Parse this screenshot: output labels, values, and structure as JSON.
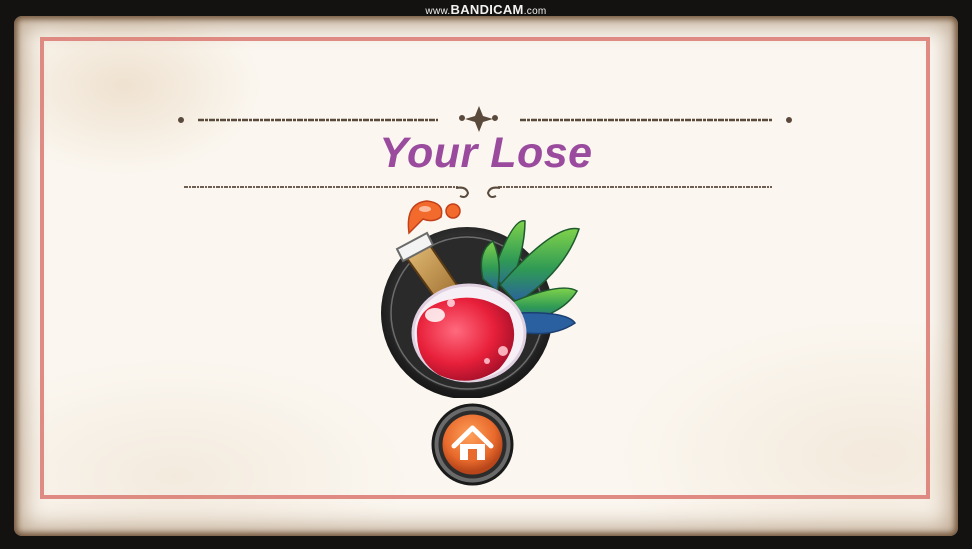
{
  "watermark": {
    "prefix": "www.",
    "brand": "BANDICAM",
    "suffix": ".com"
  },
  "result": {
    "title": "Your Lose"
  },
  "icons": {
    "potion": "potion-bottle-icon",
    "leaves": "leaves-icon",
    "home": "home-icon"
  },
  "colors": {
    "title": "#9a4b9e",
    "border": "#dc8078",
    "paper": "#fbf7f0",
    "home_button": "#e86a2c"
  }
}
